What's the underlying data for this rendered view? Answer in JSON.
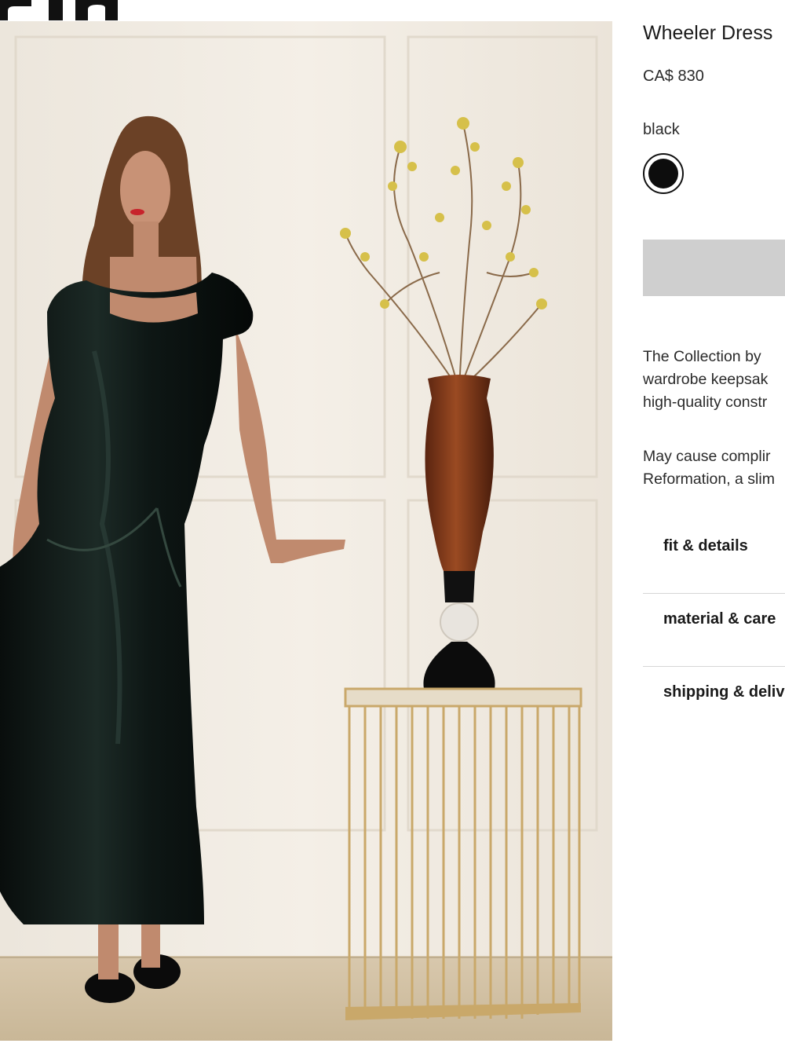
{
  "header": {
    "logo_alt": "brand wordmark (cropped)"
  },
  "product": {
    "title": "Wheeler Dress",
    "price": "CA$ 830",
    "color_label": "black",
    "swatches": [
      {
        "name": "black",
        "hex": "#0d0d0d",
        "selected": true
      }
    ],
    "add_button_label": "",
    "description_1": [
      "The Collection by",
      "wardrobe keepsak",
      "high-quality constr"
    ],
    "description_2": [
      "May cause complir",
      "Reformation, a slim"
    ]
  },
  "accordion": [
    {
      "label": "fit & details"
    },
    {
      "label": "material & care"
    },
    {
      "label": "shipping & delive"
    }
  ],
  "colors": {
    "button_disabled": "#cfcfcf",
    "divider": "#d6d6d6",
    "dress": "#0f1a17",
    "backdrop": "#f1ece4"
  }
}
